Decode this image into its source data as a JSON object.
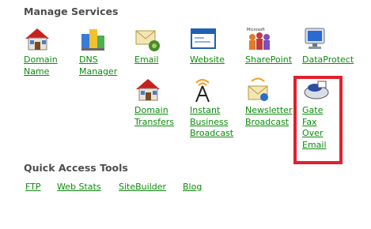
{
  "sections": {
    "manage_services": "Manage Services",
    "quick_access": "Quick Access Tools"
  },
  "services": [
    {
      "label": "Domain Name",
      "icon": "domain-name-icon"
    },
    {
      "label": "DNS Manager",
      "icon": "dns-manager-icon"
    },
    {
      "label": "Email",
      "icon": "email-icon"
    },
    {
      "label": "Website",
      "icon": "website-icon"
    },
    {
      "label": "SharePoint",
      "icon": "sharepoint-icon"
    },
    {
      "label": "DataProtect",
      "icon": "dataprotect-icon"
    },
    {
      "label": "Domain Transfers",
      "icon": "domain-transfers-icon"
    },
    {
      "label": "Instant Business Broadcast",
      "icon": "broadcast-tower-icon"
    },
    {
      "label": "Newsletter Broadcast",
      "icon": "newsletter-icon"
    },
    {
      "label": "Gate Fax Over Email",
      "icon": "fax-icon"
    }
  ],
  "icon_text": {
    "microsoft": "Microsoft"
  },
  "quick_tools": [
    "FTP",
    "Web Stats",
    "SiteBuilder",
    "Blog"
  ],
  "colors": {
    "link": "#0b8d0b",
    "heading": "#4d4d4d",
    "highlight": "#e0202c"
  }
}
